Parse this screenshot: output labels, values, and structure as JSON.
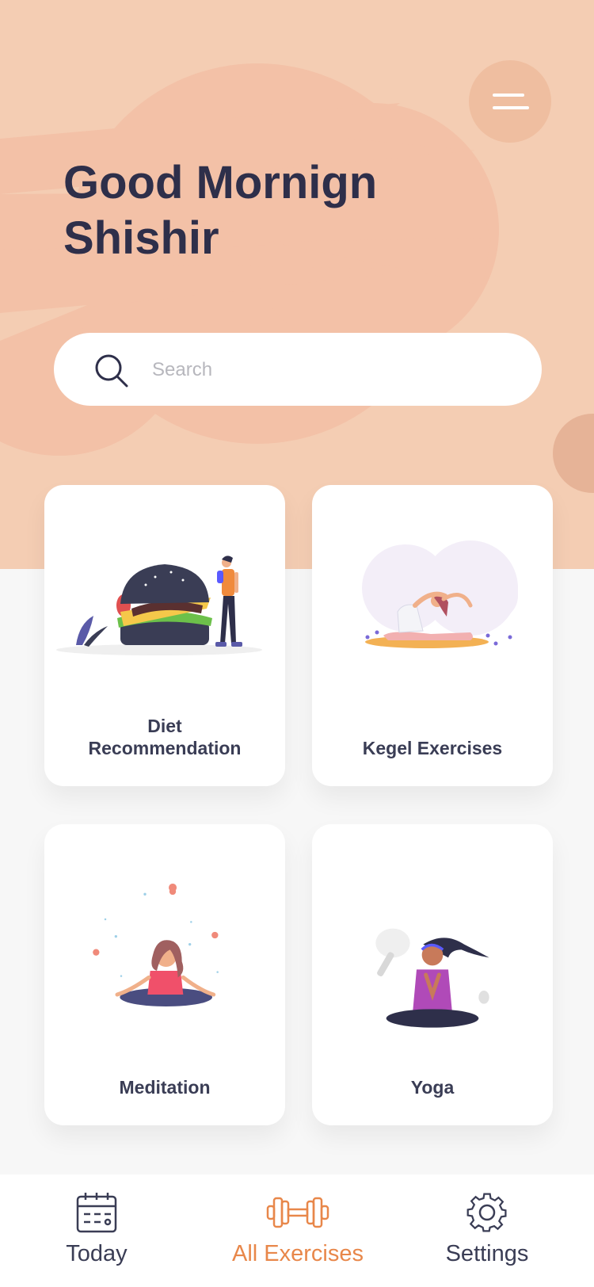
{
  "header": {
    "greeting_line1": "Good Mornign",
    "greeting_line2": "Shishir"
  },
  "search": {
    "placeholder": "Search",
    "value": ""
  },
  "cards": [
    {
      "label_line1": "Diet",
      "label_line2": "Recommendation"
    },
    {
      "label": "Kegel Exercises"
    },
    {
      "label": "Meditation"
    },
    {
      "label": "Yoga"
    }
  ],
  "nav": {
    "items": [
      {
        "label": "Today",
        "icon": "calendar-icon",
        "active": false
      },
      {
        "label": "All Exercises",
        "icon": "dumbbell-icon",
        "active": true
      },
      {
        "label": "Settings",
        "icon": "gear-icon",
        "active": false
      }
    ]
  },
  "colors": {
    "hero_bg": "#f4cdb3",
    "accent": "#e8874a",
    "text_dark": "#2e2f4a",
    "page_bg": "#f7f7f7"
  }
}
